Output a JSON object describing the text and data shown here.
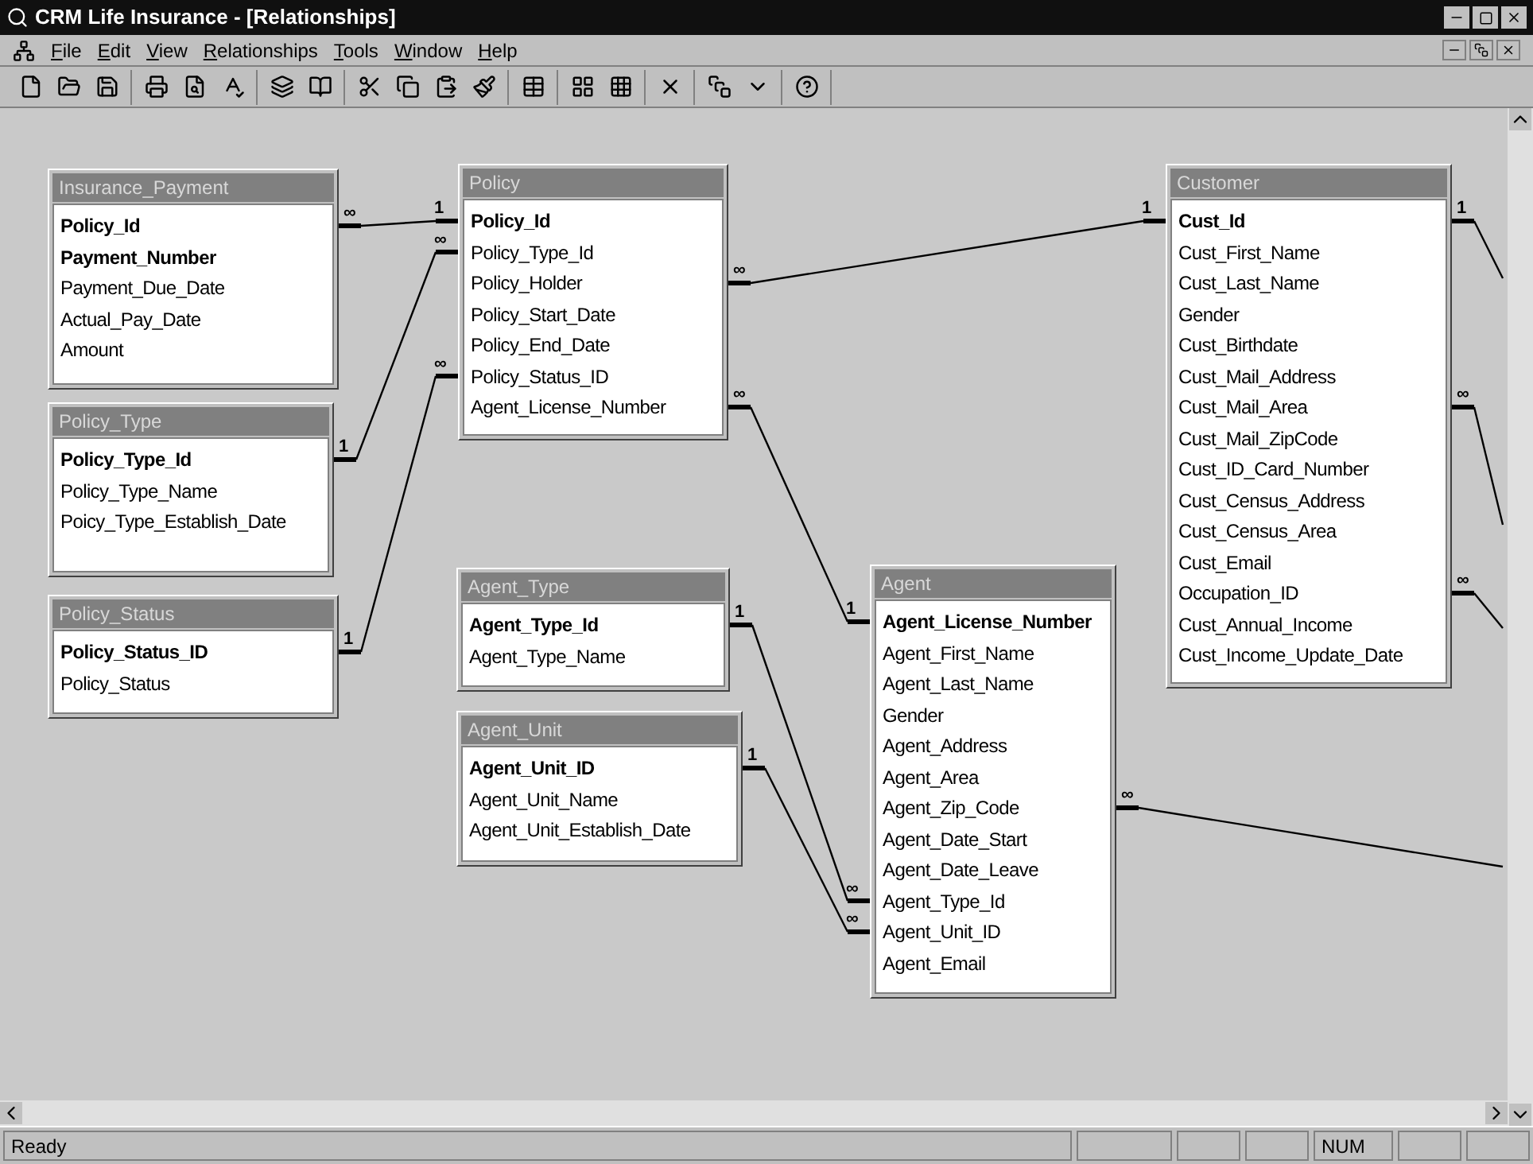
{
  "window": {
    "title": "CRM Life Insurance - [Relationships]"
  },
  "menu": [
    "File",
    "Edit",
    "View",
    "Relationships",
    "Tools",
    "Window",
    "Help"
  ],
  "tables": [
    {
      "title": "Insurance_Payment",
      "fields": [
        {
          "name": "Policy_Id",
          "key": true
        },
        {
          "name": "Payment_Number",
          "key": true
        },
        {
          "name": "Payment_Due_Date",
          "key": false
        },
        {
          "name": "Actual_Pay_Date",
          "key": false
        },
        {
          "name": "Amount",
          "key": false
        }
      ]
    },
    {
      "title": "Policy",
      "fields": [
        {
          "name": "Policy_Id",
          "key": true
        },
        {
          "name": "Policy_Type_Id",
          "key": false
        },
        {
          "name": "Policy_Holder",
          "key": false
        },
        {
          "name": "Policy_Start_Date",
          "key": false
        },
        {
          "name": "Policy_End_Date",
          "key": false
        },
        {
          "name": "Policy_Status_ID",
          "key": false
        },
        {
          "name": "Agent_License_Number",
          "key": false
        }
      ]
    },
    {
      "title": "Customer",
      "fields": [
        {
          "name": "Cust_Id",
          "key": true
        },
        {
          "name": "Cust_First_Name",
          "key": false
        },
        {
          "name": "Cust_Last_Name",
          "key": false
        },
        {
          "name": "Gender",
          "key": false
        },
        {
          "name": "Cust_Birthdate",
          "key": false
        },
        {
          "name": "Cust_Mail_Address",
          "key": false
        },
        {
          "name": "Cust_Mail_Area",
          "key": false
        },
        {
          "name": "Cust_Mail_ZipCode",
          "key": false
        },
        {
          "name": "Cust_ID_Card_Number",
          "key": false
        },
        {
          "name": "Cust_Census_Address",
          "key": false
        },
        {
          "name": "Cust_Census_Area",
          "key": false
        },
        {
          "name": "Cust_Email",
          "key": false
        },
        {
          "name": "Occupation_ID",
          "key": false
        },
        {
          "name": "Cust_Annual_Income",
          "key": false
        },
        {
          "name": "Cust_Income_Update_Date",
          "key": false
        }
      ]
    },
    {
      "title": "Policy_Type",
      "fields": [
        {
          "name": "Policy_Type_Id",
          "key": true
        },
        {
          "name": "Policy_Type_Name",
          "key": false
        },
        {
          "name": "Poicy_Type_Establish_Date",
          "key": false
        }
      ]
    },
    {
      "title": "Policy_Status",
      "fields": [
        {
          "name": "Policy_Status_ID",
          "key": true
        },
        {
          "name": "Policy_Status",
          "key": false
        }
      ]
    },
    {
      "title": "Agent_Type",
      "fields": [
        {
          "name": "Agent_Type_Id",
          "key": true
        },
        {
          "name": "Agent_Type_Name",
          "key": false
        }
      ]
    },
    {
      "title": "Agent_Unit",
      "fields": [
        {
          "name": "Agent_Unit_ID",
          "key": true
        },
        {
          "name": "Agent_Unit_Name",
          "key": false
        },
        {
          "name": "Agent_Unit_Establish_Date",
          "key": false
        }
      ]
    },
    {
      "title": "Agent",
      "fields": [
        {
          "name": "Agent_License_Number",
          "key": true
        },
        {
          "name": "Agent_First_Name",
          "key": false
        },
        {
          "name": "Agent_Last_Name",
          "key": false
        },
        {
          "name": "Gender",
          "key": false
        },
        {
          "name": "Agent_Address",
          "key": false
        },
        {
          "name": "Agent_Area",
          "key": false
        },
        {
          "name": "Agent_Zip_Code",
          "key": false
        },
        {
          "name": "Agent_Date_Start",
          "key": false
        },
        {
          "name": "Agent_Date_Leave",
          "key": false
        },
        {
          "name": "Agent_Type_Id",
          "key": false
        },
        {
          "name": "Agent_Unit_ID",
          "key": false
        },
        {
          "name": "Agent_Email",
          "key": false
        }
      ]
    }
  ],
  "relationships": [
    {
      "kind": "internal",
      "ends": [
        "∞",
        "1"
      ]
    },
    {
      "kind": "internal",
      "ends": [
        "1",
        "∞"
      ]
    },
    {
      "kind": "internal",
      "ends": [
        "1",
        "∞"
      ]
    },
    {
      "kind": "internal",
      "ends": [
        "∞",
        "1"
      ]
    },
    {
      "kind": "internal",
      "ends": [
        "∞",
        "1"
      ]
    },
    {
      "kind": "internal",
      "ends": [
        "1",
        "∞"
      ]
    },
    {
      "kind": "internal",
      "ends": [
        "1",
        "∞"
      ]
    },
    {
      "kind": "offscreen",
      "ends": [
        "1"
      ]
    },
    {
      "kind": "offscreen",
      "ends": [
        "∞"
      ]
    },
    {
      "kind": "offscreen",
      "ends": [
        "∞"
      ]
    },
    {
      "kind": "offscreen",
      "ends": [
        "∞"
      ]
    }
  ],
  "status_bar": {
    "message": "Ready",
    "indicators": [
      "NUM"
    ]
  }
}
